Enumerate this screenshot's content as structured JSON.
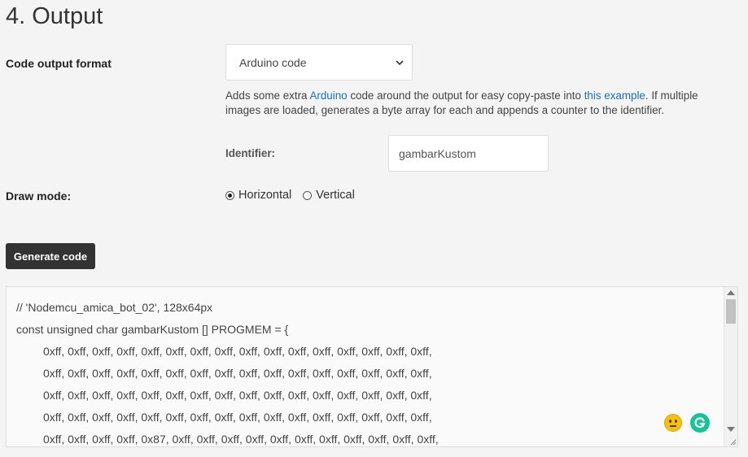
{
  "section": {
    "title": "4. Output"
  },
  "output_format": {
    "label": "Code output format",
    "selected": "Arduino code",
    "help_prefix": "Adds some extra ",
    "help_link1": "Arduino",
    "help_mid": " code around the output for easy copy-paste into ",
    "help_link2": "this example",
    "help_suffix": ". If multiple images are loaded, generates a byte array for each and appends a counter to the identifier."
  },
  "identifier": {
    "label": "Identifier:",
    "value": "gambarKustom"
  },
  "draw_mode": {
    "label": "Draw mode:",
    "options": [
      {
        "label": "Horizontal",
        "checked": true
      },
      {
        "label": "Vertical",
        "checked": false
      }
    ]
  },
  "actions": {
    "generate_label": "Generate code"
  },
  "code_output": {
    "lines": [
      "// 'Nodemcu_amica_bot_02', 128x64px",
      "const unsigned char gambarKustom [] PROGMEM = {",
      "0xff, 0xff, 0xff, 0xff, 0xff, 0xff, 0xff, 0xff, 0xff, 0xff, 0xff, 0xff, 0xff, 0xff, 0xff, 0xff,",
      "0xff, 0xff, 0xff, 0xff, 0xff, 0xff, 0xff, 0xff, 0xff, 0xff, 0xff, 0xff, 0xff, 0xff, 0xff, 0xff,",
      "0xff, 0xff, 0xff, 0xff, 0xff, 0xff, 0xff, 0xff, 0xff, 0xff, 0xff, 0xff, 0xff, 0xff, 0xff, 0xff,",
      "0xff, 0xff, 0xff, 0xff, 0xff, 0xff, 0xff, 0xff, 0xff, 0xff, 0xff, 0xff, 0xff, 0xff, 0xff, 0xff,",
      "0xff, 0xff, 0xff, 0xff, 0x87, 0xff, 0xff, 0xff, 0xff, 0xff, 0xff, 0xff, 0xff, 0xff, 0xff, 0xff,"
    ]
  },
  "icons": {
    "select_chevron": "chevron-down-icon",
    "emoji": "neutral-face-icon",
    "grammarly": "grammarly-icon"
  },
  "colors": {
    "link": "#1a6fc0",
    "button_bg": "#333333",
    "grammarly": "#15c39a"
  }
}
